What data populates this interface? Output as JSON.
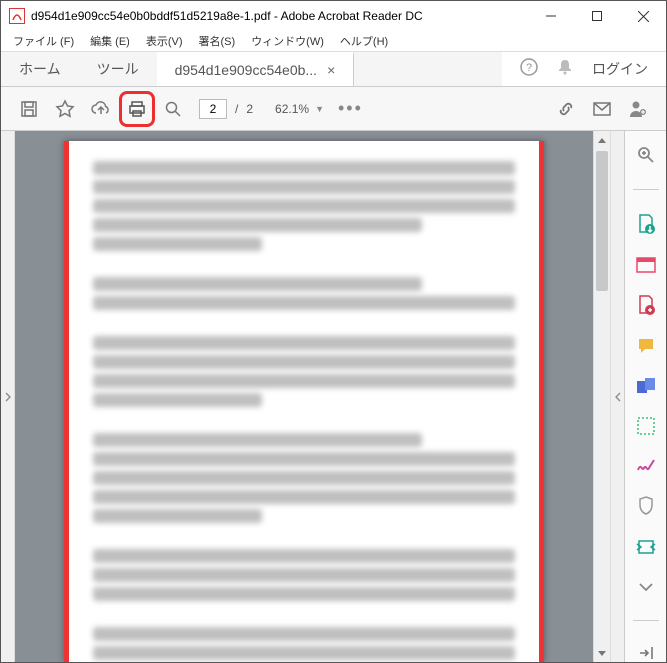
{
  "window": {
    "title": "d954d1e909cc54e0b0bddf51d5219a8e-1.pdf - Adobe Acrobat Reader DC"
  },
  "menu": {
    "file": "ファイル (F)",
    "edit": "編集 (E)",
    "view": "表示(V)",
    "sign": "署名(S)",
    "window": "ウィンドウ(W)",
    "help": "ヘルプ(H)"
  },
  "tabs": {
    "home": "ホーム",
    "tools": "ツール",
    "doc": "d954d1e909cc54e0b...",
    "login": "ログイン"
  },
  "toolbar": {
    "page_current": "2",
    "page_total": "2",
    "page_sep": "/",
    "zoom": "62.1%"
  }
}
